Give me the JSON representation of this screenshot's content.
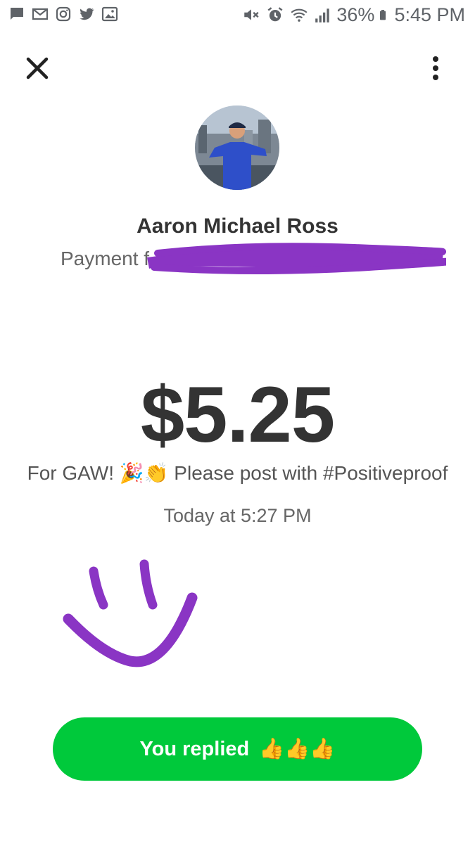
{
  "status_bar": {
    "battery": "36%",
    "time": "5:45 PM",
    "left_icons": [
      "message-icon",
      "gmail-icon",
      "instagram-icon",
      "twitter-icon",
      "gallery-icon"
    ],
    "right_icons": [
      "mute-icon",
      "alarm-icon",
      "wifi-icon",
      "signal-icon",
      "battery-icon"
    ]
  },
  "header": {
    "close_icon": "close-icon",
    "menu_icon": "more-vert-icon"
  },
  "payment": {
    "payer_name": "Aaron Michael Ross",
    "payment_prefix": "Payment f",
    "amount": "$5.25",
    "note_start": "For GAW! ",
    "note_emoji": "🎉👏",
    "note_end": " Please post with #Positiveproof",
    "timestamp": "Today at 5:27 PM"
  },
  "reply": {
    "label": "You replied",
    "emoji": "👍👍👍"
  },
  "colors": {
    "accent_green": "#00c93b",
    "redaction_purple": "#8a35c4",
    "text_dark": "#333333"
  }
}
